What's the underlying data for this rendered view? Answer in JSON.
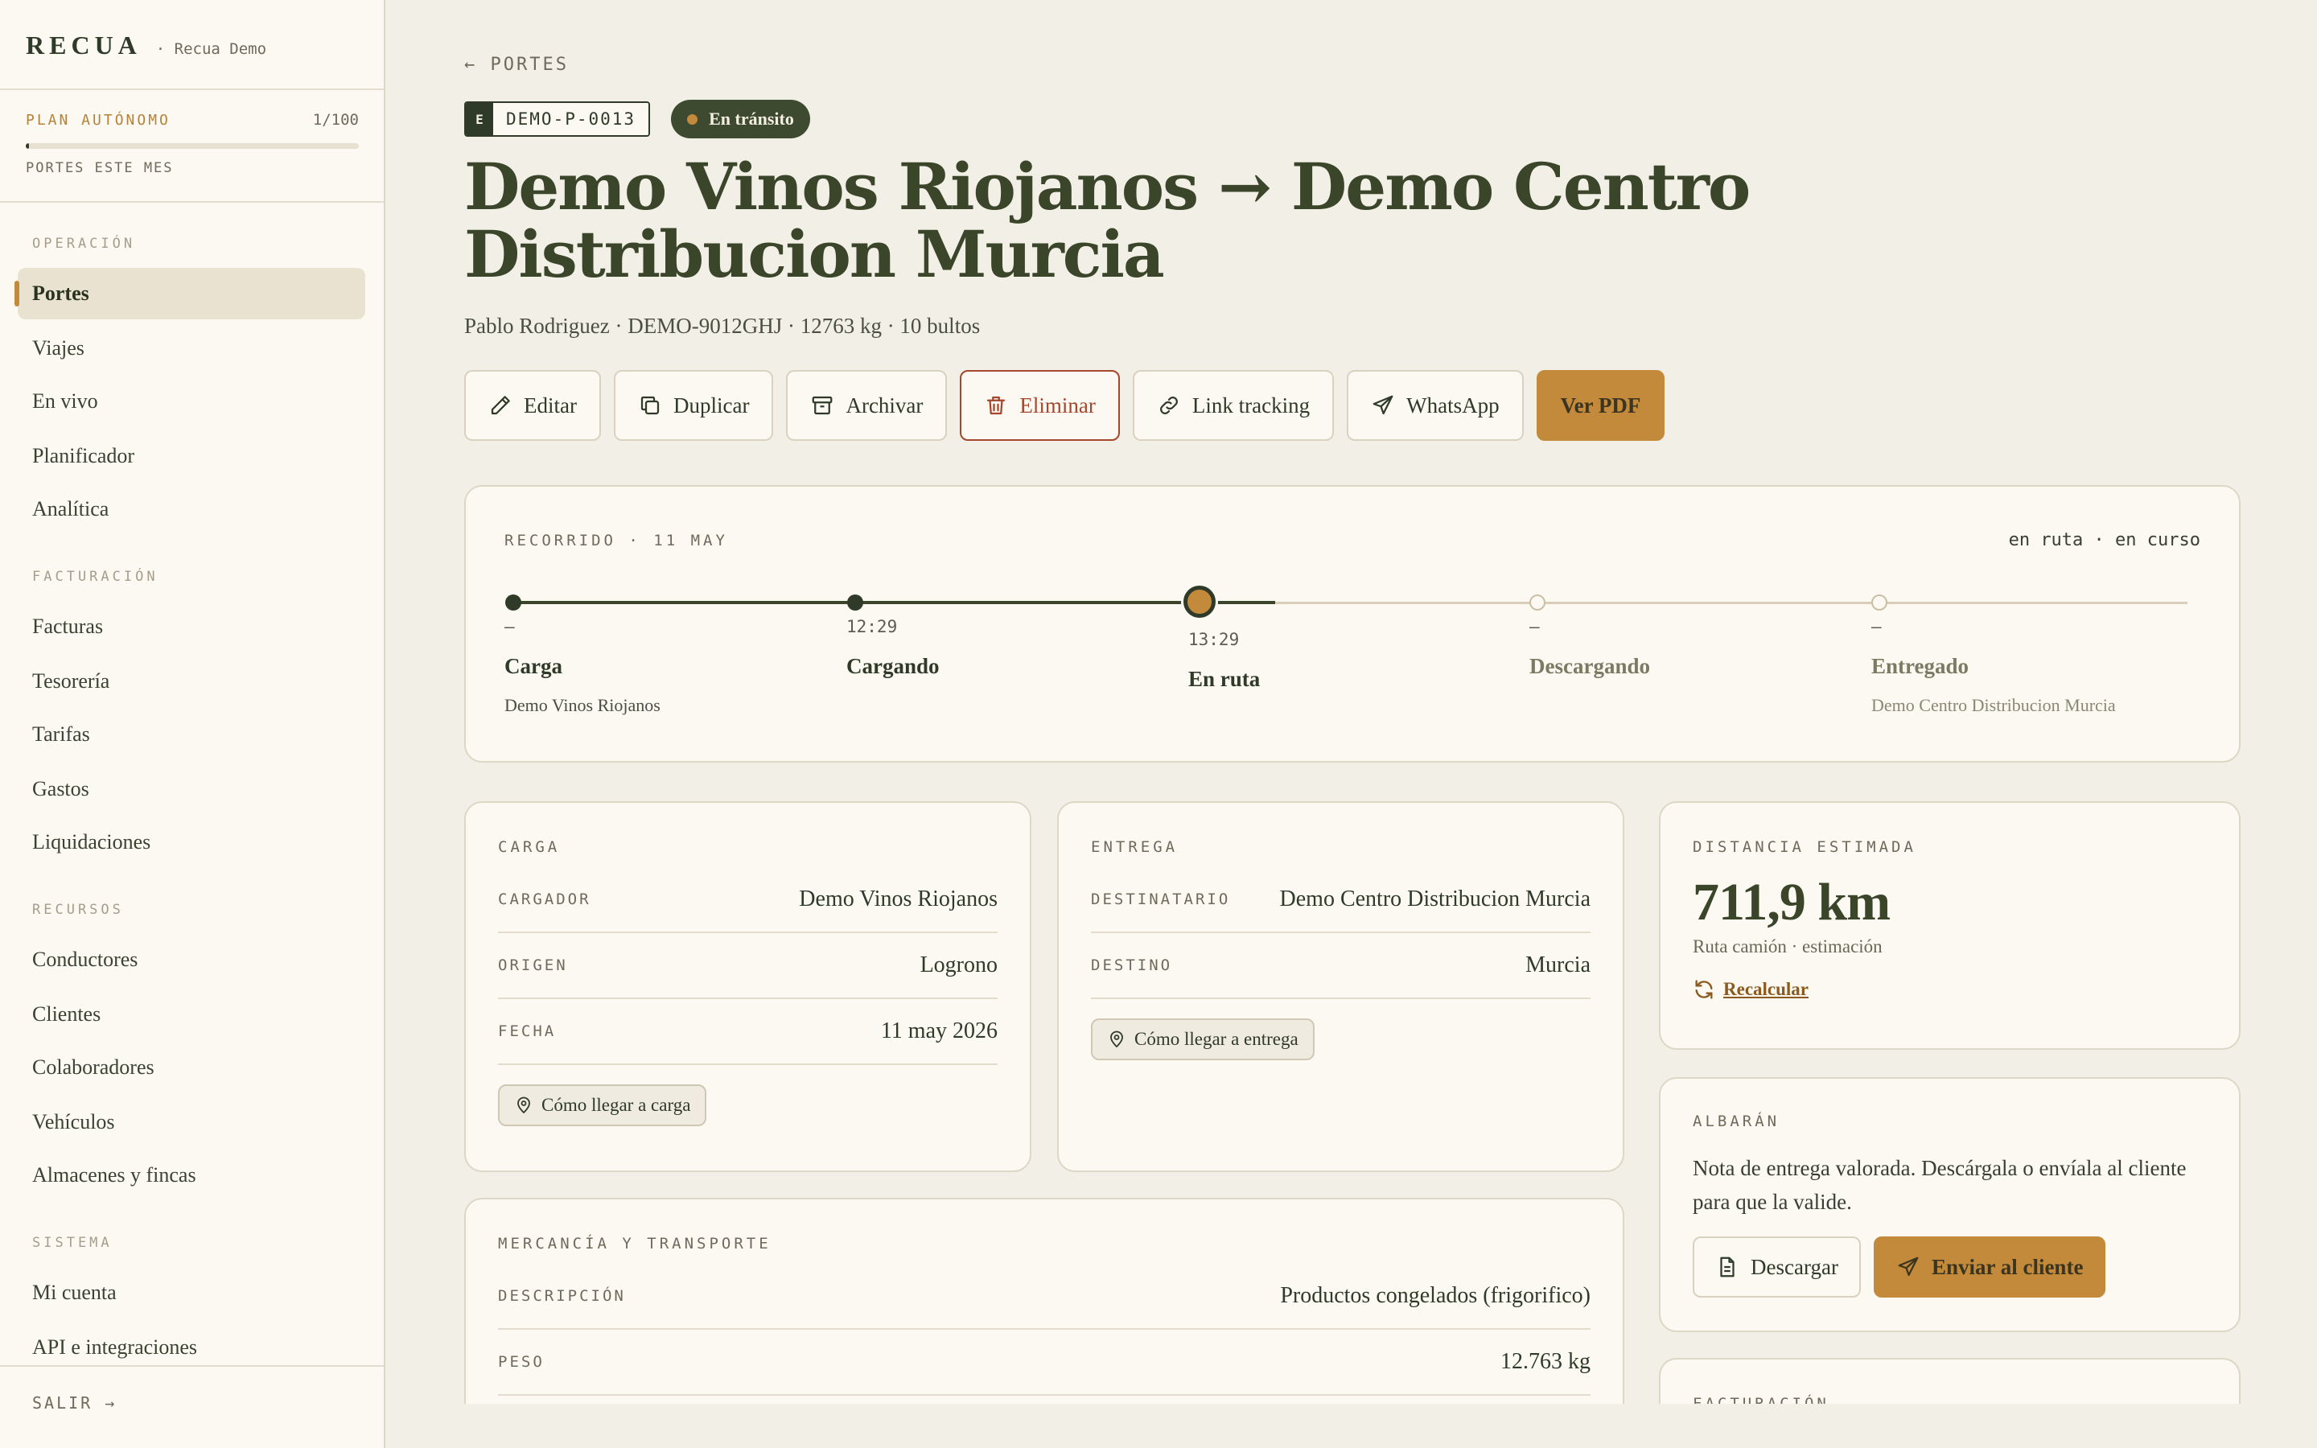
{
  "sidebar": {
    "brand": "RECUA",
    "workspace": "· Recua Demo",
    "plan_label": "PLAN AUTÓNOMO",
    "plan_count": "1/100",
    "plan_progress": 0.01,
    "plan_sub": "PORTES ESTE MES",
    "sections": [
      {
        "title": "OPERACIÓN",
        "items": [
          "Portes",
          "Viajes",
          "En vivo",
          "Planificador",
          "Analítica"
        ]
      },
      {
        "title": "FACTURACIÓN",
        "items": [
          "Facturas",
          "Tesorería",
          "Tarifas",
          "Gastos",
          "Liquidaciones"
        ]
      },
      {
        "title": "RECURSOS",
        "items": [
          "Conductores",
          "Clientes",
          "Colaboradores",
          "Vehículos",
          "Almacenes y fincas"
        ]
      },
      {
        "title": "SISTEMA",
        "items": [
          "Mi cuenta",
          "API e integraciones"
        ]
      }
    ],
    "active_item": "Portes",
    "logout": "SALIR →"
  },
  "header": {
    "back": "← PORTES",
    "tag_letter": "E",
    "code": "DEMO-P-0013",
    "status": "En tránsito",
    "title": "Demo Vinos Riojanos → Demo Centro Distribucion Murcia",
    "subtitle": "Pablo Rodriguez · DEMO-9012GHJ · 12763 kg · 10 bultos"
  },
  "actions": {
    "edit": "Editar",
    "duplicate": "Duplicar",
    "archive": "Archivar",
    "delete": "Eliminar",
    "tracking": "Link tracking",
    "whatsapp": "WhatsApp",
    "pdf": "Ver PDF"
  },
  "timeline": {
    "title": "RECORRIDO · 11 MAY",
    "status": "en ruta · en curso",
    "stages": [
      {
        "time": "–",
        "name": "Carga",
        "place": "Demo Vinos Riojanos",
        "state": "done"
      },
      {
        "time": "12:29",
        "name": "Cargando",
        "place": "",
        "state": "done"
      },
      {
        "time": "13:29",
        "name": "En ruta",
        "place": "",
        "state": "current"
      },
      {
        "time": "–",
        "name": "Descargando",
        "place": "",
        "state": "pending"
      },
      {
        "time": "–",
        "name": "Entregado",
        "place": "Demo Centro Distribucion Murcia",
        "state": "pending"
      }
    ]
  },
  "carga": {
    "title": "CARGA",
    "rows": [
      {
        "key": "CARGADOR",
        "value": "Demo Vinos Riojanos"
      },
      {
        "key": "ORIGEN",
        "value": "Logrono"
      },
      {
        "key": "FECHA",
        "value": "11 may 2026"
      }
    ],
    "chip": "Cómo llegar a carga"
  },
  "entrega": {
    "title": "ENTREGA",
    "rows": [
      {
        "key": "DESTINATARIO",
        "value": "Demo Centro Distribucion Murcia"
      },
      {
        "key": "DESTINO",
        "value": "Murcia"
      }
    ],
    "chip": "Cómo llegar a entrega"
  },
  "distancia": {
    "title": "DISTANCIA ESTIMADA",
    "value": "711,9 km",
    "note": "Ruta camión · estimación",
    "recalc": "Recalcular"
  },
  "albaran": {
    "title": "ALBARÁN",
    "text": "Nota de entrega valorada. Descárgala o envíala al cliente para que la valide.",
    "download": "Descargar",
    "send": "Enviar al cliente"
  },
  "mercancia": {
    "title": "MERCANCÍA Y TRANSPORTE",
    "rows": [
      {
        "key": "DESCRIPCIÓN",
        "value": "Productos congelados (frigorifico)"
      },
      {
        "key": "PESO",
        "value": "12.763 kg"
      }
    ]
  },
  "facturacion": {
    "title": "FACTURACIÓN"
  },
  "colors": {
    "accent": "#c48a3b",
    "ink": "#2f3a28",
    "danger": "#a5472c",
    "background": "#f2efe7"
  }
}
